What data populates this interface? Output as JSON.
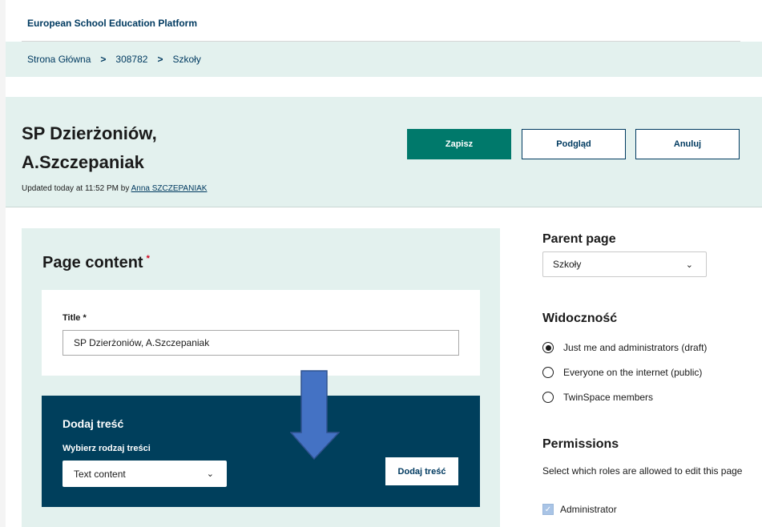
{
  "topbar": {
    "brand": "European School Education Platform"
  },
  "breadcrumb": {
    "items": [
      "Strona Główna",
      "308782",
      "Szkoły"
    ],
    "separator": ">"
  },
  "header": {
    "title": "SP Dzierżoniów, A.Szczepaniak",
    "updated_prefix": "Updated today at 11:52 PM by",
    "updated_author": "Anna SZCZEPANIAK",
    "buttons": {
      "save": "Zapisz",
      "preview": "Podgląd",
      "cancel": "Anuluj"
    }
  },
  "content": {
    "section_title": "Page content",
    "required_mark": "*",
    "title_label": "Title *",
    "title_value": "SP Dzierżoniów, A.Szczepaniak",
    "add": {
      "heading": "Dodaj treść",
      "type_label": "Wybierz rodzaj treści",
      "type_value": "Text content",
      "button": "Dodaj treść"
    }
  },
  "sidebar": {
    "parent_title": "Parent page",
    "parent_value": "Szkoły",
    "visibility_title": "Widoczność",
    "visibility_options": [
      {
        "label": "Just me and administrators (draft)",
        "selected": true
      },
      {
        "label": "Everyone on the internet (public)",
        "selected": false
      },
      {
        "label": "TwinSpace members",
        "selected": false
      }
    ],
    "permissions_title": "Permissions",
    "permissions_desc": "Select which roles are allowed to edit this page",
    "permissions_roles": [
      {
        "label": "Administrator",
        "checked": true
      }
    ]
  },
  "colors": {
    "accent": "#00796b",
    "panel": "#e3f1ee",
    "dark": "#003f5c",
    "arrow": "#4472c4"
  },
  "icons": {
    "chevron": "chevron-down-icon",
    "arrow": "down-arrow-icon"
  }
}
